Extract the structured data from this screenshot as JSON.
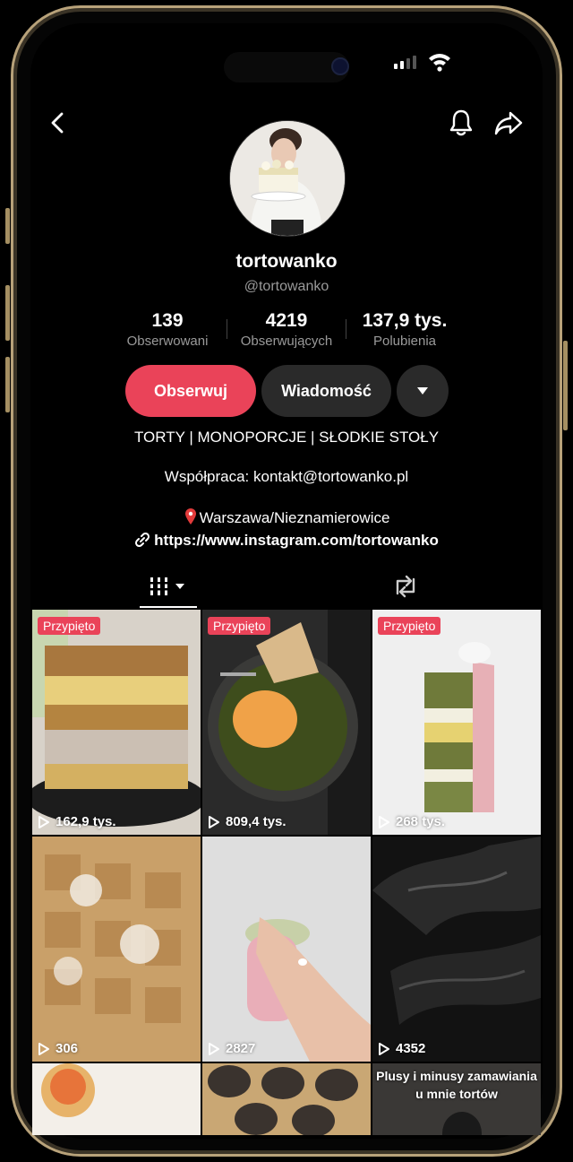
{
  "profile": {
    "display_name": "tortowanko",
    "handle": "@tortowanko"
  },
  "stats": [
    {
      "value": "139",
      "label": "Obserwowani"
    },
    {
      "value": "4219",
      "label": "Obserwujących"
    },
    {
      "value": "137,9 tys.",
      "label": "Polubienia"
    }
  ],
  "actions": {
    "follow_label": "Obserwuj",
    "message_label": "Wiadomość",
    "follow_color": "#ea4359"
  },
  "bio": {
    "line1": "TORTY | MONOPORCJE | SŁODKIE STOŁY",
    "line2": "Współpraca: kontakt@tortowanko.pl",
    "line3": "Warszawa/Nieznamierowice",
    "link": "https://www.instagram.com/tortowanko"
  },
  "videos": [
    {
      "pinned": true,
      "pin_label": "Przypięto",
      "views": "162,9 tys."
    },
    {
      "pinned": true,
      "pin_label": "Przypięto",
      "views": "809,4 tys."
    },
    {
      "pinned": true,
      "pin_label": "Przypięto",
      "views": "268 tys."
    },
    {
      "pinned": false,
      "views": "306"
    },
    {
      "pinned": false,
      "views": "2827"
    },
    {
      "pinned": false,
      "views": "4352"
    },
    {
      "caption": "Plusy i minusy zamawiania u mnie tortów"
    }
  ],
  "icons": {
    "back": "back-chevron-icon",
    "bell": "bell-icon",
    "share": "share-icon",
    "pin": "location-pin-icon",
    "link": "link-icon",
    "grid_tab": "grid-tab-icon",
    "repost_tab": "repost-icon",
    "play": "play-icon"
  }
}
